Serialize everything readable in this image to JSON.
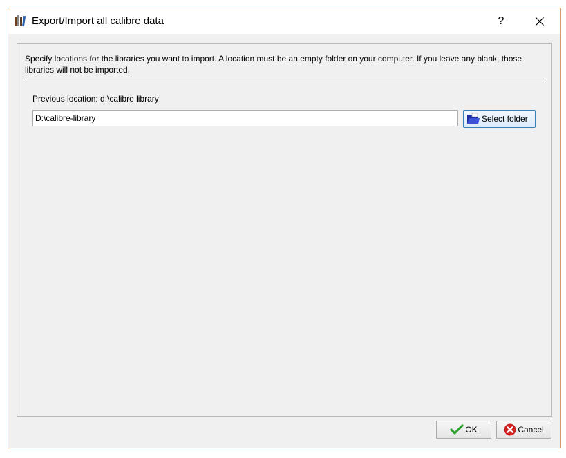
{
  "window": {
    "title": "Export/Import all calibre data",
    "help_label": "?",
    "close_label": "✕"
  },
  "dialog": {
    "instructions": "Specify locations for the libraries you want to import. A location must be an empty folder on your computer. If you leave any blank, those libraries will not be imported.",
    "previous_location_label": "Previous location: d:\\calibre library",
    "path_value": "D:\\calibre-library",
    "select_folder_label": "Select folder"
  },
  "buttons": {
    "ok_label": "OK",
    "cancel_label": "Cancel"
  },
  "colors": {
    "ok_check": "#2ea02e",
    "cancel_red": "#cc2222",
    "folder_blue": "#2a3fb8",
    "frame_border": "#d59a6e"
  },
  "icons": {
    "app": "calibre-books-icon",
    "folder": "open-folder-icon",
    "ok": "checkmark-icon",
    "cancel": "cancel-x-icon"
  }
}
